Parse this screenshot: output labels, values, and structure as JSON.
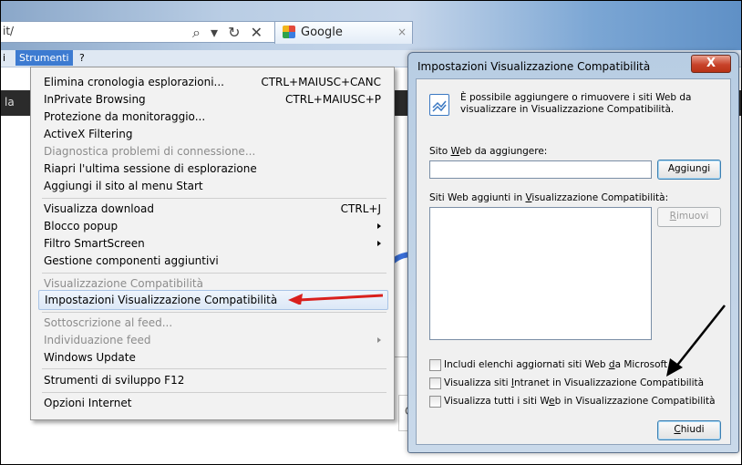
{
  "browser": {
    "address_text": "it/",
    "address_icons": "⌕ ▾ ↻ ✕",
    "tab_title": "Google",
    "tab_close": "×",
    "menubar_left": "i",
    "menubar_strumenti": "Strumenti",
    "menubar_help": "?",
    "darkbar_text": "la"
  },
  "tools_menu": {
    "items": [
      {
        "label": "Elimina cronologia esplorazioni...",
        "shortcut": "CTRL+MAIUSC+CANC"
      },
      {
        "label": "InPrivate Browsing",
        "shortcut": "CTRL+MAIUSC+P"
      },
      {
        "label": "Protezione da monitoraggio..."
      },
      {
        "label": "ActiveX Filtering"
      },
      {
        "label": "Diagnostica problemi di connessione..."
      },
      {
        "label": "Riapri l'ultima sessione di esplorazione"
      },
      {
        "label": "Aggiungi il sito al menu Start"
      },
      {
        "label": "Visualizza download",
        "shortcut": "CTRL+J"
      },
      {
        "label": "Blocco popup"
      },
      {
        "label": "Filtro SmartScreen"
      },
      {
        "label": "Gestione componenti aggiuntivi"
      },
      {
        "label": "Visualizzazione Compatibilità"
      },
      {
        "label": "Impostazioni Visualizzazione Compatibilità"
      },
      {
        "label": "Sottoscrizione al feed..."
      },
      {
        "label": "Individuazione feed"
      },
      {
        "label": "Windows Update"
      },
      {
        "label": "Strumenti di sviluppo F12"
      },
      {
        "label": "Opzioni Internet"
      }
    ]
  },
  "dialog": {
    "title": "Impostazioni Visualizzazione Compatibilità",
    "close": "X",
    "info": "È possibile aggiungere o rimuovere i siti Web da visualizzare in Visualizzazione Compatibilità.",
    "add_label_pre": "Sito ",
    "add_label_u": "W",
    "add_label_post": "eb da aggiungere:",
    "add_input_value": "",
    "add_button": "Aggiungi",
    "list_label_pre": "Siti Web aggiunti in ",
    "list_label_u": "V",
    "list_label_post": "isualizzazione Compatibilità:",
    "remove_button_u": "R",
    "remove_button_post": "imuovi",
    "checkbox1_pre": "Includi elenchi aggiornati siti Web ",
    "checkbox1_u": "d",
    "checkbox1_post": "a Microsoft",
    "checkbox2_pre": "Visualizza siti ",
    "checkbox2_u": "I",
    "checkbox2_post": "ntranet in Visualizzazione Compatibilità",
    "checkbox3_pre": "Visualizza tutti i siti W",
    "checkbox3_u": "e",
    "checkbox3_post": "b in Visualizzazione Compatibilità",
    "close_button_u": "C",
    "close_button_post": "hiudi"
  },
  "colors": {
    "menu_highlight": "#dce8f7",
    "red_arrow": "#d9201c",
    "dialog_frame": "#b8cde3"
  }
}
